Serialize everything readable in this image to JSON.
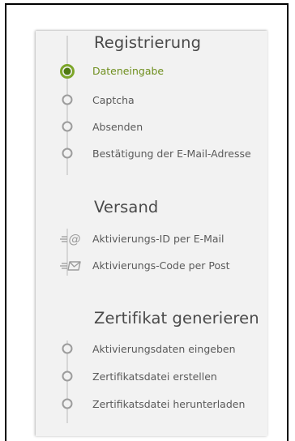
{
  "sections": [
    {
      "title": "Registrierung",
      "items": [
        {
          "label": "Dateneingabe",
          "icon": "active-step-icon",
          "active": true
        },
        {
          "label": "Captcha",
          "icon": "step-circle-icon"
        },
        {
          "label": "Absenden",
          "icon": "step-circle-icon"
        },
        {
          "label": "Bestätigung der E-Mail-Adresse",
          "icon": "step-circle-icon"
        }
      ]
    },
    {
      "title": "Versand",
      "items": [
        {
          "label": "Aktivierungs-ID per E-Mail",
          "icon": "email-at-icon"
        },
        {
          "label": "Aktivierungs-Code per Post",
          "icon": "letter-envelope-icon"
        }
      ]
    },
    {
      "title": "Zertifikat generieren",
      "items": [
        {
          "label": "Aktivierungsdaten eingeben",
          "icon": "step-circle-icon"
        },
        {
          "label": "Zertifikatsdatei erstellen",
          "icon": "step-circle-icon"
        },
        {
          "label": "Zertifikatsdatei herunterladen",
          "icon": "step-circle-icon"
        }
      ]
    }
  ],
  "colors": {
    "active_green": "#7da62a",
    "active_green_dark": "#4f7a12",
    "text": "#5a5a5a",
    "heading": "#4a4a4a",
    "rail": "#d6d6d6",
    "panel_bg": "#f2f2f2"
  }
}
